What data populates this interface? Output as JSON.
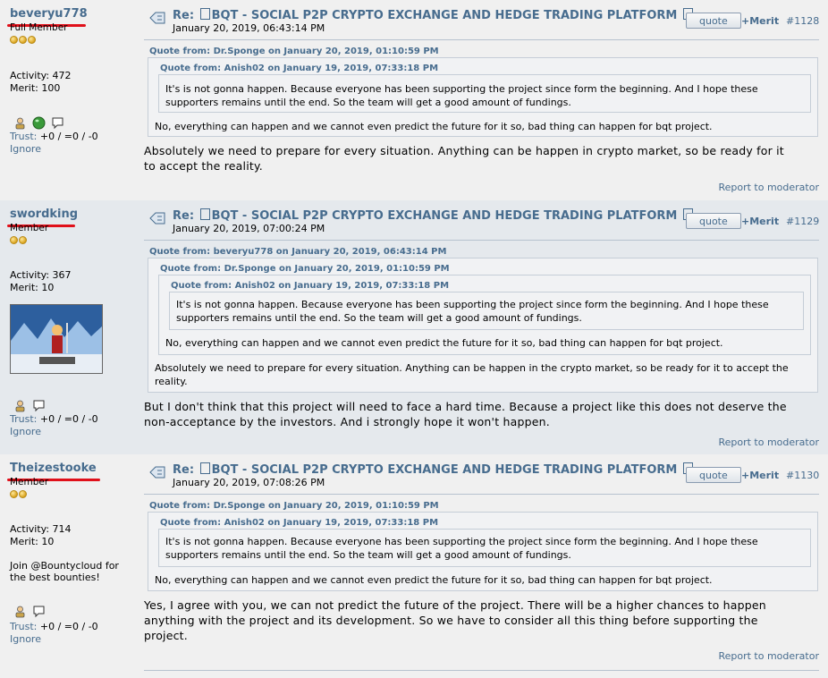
{
  "posts": [
    {
      "username": "beveryu778",
      "rank": "Full Member",
      "activity": "Activity: 472",
      "merit_stat": "Merit: 100",
      "trust_label": "Trust:",
      "trust_value": "+0 / =0 / -0",
      "ignore": "Ignore",
      "subject_prefix": "Re:",
      "subject": "BQT - SOCIAL P2P CRYPTO EXCHANGE AND HEDGE TRADING PLATFORM",
      "date": "January 20, 2019, 06:43:14 PM",
      "quote_btn": "quote",
      "merit_btn": "+Merit",
      "number": "#1128",
      "quote1_header": "Quote from: Dr.Sponge on January 20, 2019, 01:10:59 PM",
      "quote2_header": "Quote from: Anish02 on January 19, 2019, 07:33:18 PM",
      "quote2_line1": "It's is not gonna happen. Because everyone has been supporting the project since form the beginning. And I hope these",
      "quote2_line2": "supporters remains until the end. So the team will get a good amount of fundings.",
      "quote1_text": "No, everything can happen and we cannot even predict the future for it so, bad thing can happen for bqt project.",
      "body_line1": "Absolutely we need to prepare for every situation. Anything can be happen in crypto market, so be ready for it",
      "body_line2": "to accept the reality.",
      "report": "Report to moderator"
    },
    {
      "username": "swordking",
      "rank": "Member",
      "activity": "Activity: 367",
      "merit_stat": "Merit: 10",
      "trust_label": "Trust:",
      "trust_value": "+0 / =0 / -0",
      "ignore": "Ignore",
      "subject_prefix": "Re:",
      "subject": "BQT - SOCIAL P2P CRYPTO EXCHANGE AND HEDGE TRADING PLATFORM",
      "date": "January 20, 2019, 07:00:24 PM",
      "quote_btn": "quote",
      "merit_btn": "+Merit",
      "number": "#1129",
      "quote0_header": "Quote from: beveryu778 on January 20, 2019, 06:43:14 PM",
      "quote1_header": "Quote from: Dr.Sponge on January 20, 2019, 01:10:59 PM",
      "quote2_header": "Quote from: Anish02 on January 19, 2019, 07:33:18 PM",
      "quote2_line1": "It's is not gonna happen. Because everyone has been supporting the project since form the beginning. And I hope these",
      "quote2_line2": "supporters remains until the end. So the team will get a good amount of fundings.",
      "quote1_text": "No, everything can happen and we cannot even predict the future for it so, bad thing can happen for bqt project.",
      "quote0_line1": "Absolutely we need to prepare for every situation. Anything can be happen in the crypto market, so be ready for it to accept the",
      "quote0_line2": "reality.",
      "body_line1": "But I don't think that this project will need to face a hard time. Because a project like this does not deserve the",
      "body_line2": "non-acceptance by the investors. And i strongly hope it won't happen.",
      "report": "Report to moderator"
    },
    {
      "username": "Theizestooke",
      "rank": "Member",
      "activity": "Activity: 714",
      "merit_stat": "Merit: 10",
      "signature_line1": "Join @Bountycloud for",
      "signature_line2": "the best bounties!",
      "trust_label": "Trust:",
      "trust_value": "+0 / =0 / -0",
      "ignore": "Ignore",
      "subject_prefix": "Re:",
      "subject": "BQT - SOCIAL P2P CRYPTO EXCHANGE AND HEDGE TRADING PLATFORM",
      "date": "January 20, 2019, 07:08:26 PM",
      "quote_btn": "quote",
      "merit_btn": "+Merit",
      "number": "#1130",
      "quote1_header": "Quote from: Dr.Sponge on January 20, 2019, 01:10:59 PM",
      "quote2_header": "Quote from: Anish02 on January 19, 2019, 07:33:18 PM",
      "quote2_line1": "It's is not gonna happen. Because everyone has been supporting the project since form the beginning. And I hope these",
      "quote2_line2": "supporters remains until the end. So the team will get a good amount of fundings.",
      "quote1_text": "No, everything can happen and we cannot even predict the future for it so, bad thing can happen for bqt project.",
      "body_line1": "Yes, I agree with you, we can not predict the future of the project. There will be a higher chances to happen",
      "body_line2": "anything with the project and its development. So we have to consider all this thing before supporting the",
      "body_line3": "project.",
      "report": "Report to moderator"
    }
  ],
  "colors": {
    "link": "#476c8e",
    "annotation": "#e0101a"
  }
}
